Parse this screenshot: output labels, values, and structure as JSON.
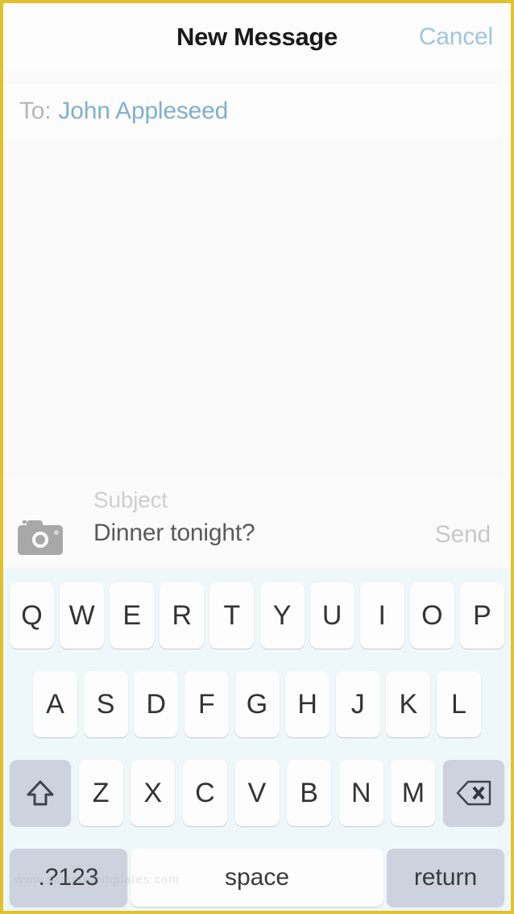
{
  "navbar": {
    "title": "New Message",
    "cancel_label": "Cancel"
  },
  "recipient": {
    "label": "To:",
    "value": "John Appleseed"
  },
  "compose": {
    "subject_placeholder": "Subject",
    "subject_value": "Dinner tonight?",
    "body_value": "",
    "send_label": "Send",
    "attach_icon": "camera-icon"
  },
  "keyboard": {
    "row1": [
      "Q",
      "W",
      "E",
      "R",
      "T",
      "Y",
      "U",
      "I",
      "O",
      "P"
    ],
    "row2": [
      "A",
      "S",
      "D",
      "F",
      "G",
      "H",
      "J",
      "K",
      "L"
    ],
    "row3_letters": [
      "Z",
      "X",
      "C",
      "V",
      "B",
      "N",
      "M"
    ],
    "shift_icon": "shift-arrow-icon",
    "backspace_icon": "backspace-delete-icon",
    "numbers_label": ".?123",
    "space_label": "space",
    "return_label": "return"
  },
  "watermark": {
    "text": "www.sampletemplates.com"
  },
  "colors": {
    "frame_border": "#e0c22e",
    "accent_blue": "#7eb1cd",
    "cancel_blue": "#9ec6dd",
    "keyboard_bg": "#eef8fb",
    "key_bg": "#fdfdfd",
    "special_key_bg": "#cdd3de",
    "disabled_gray": "#c9c9c9",
    "body_bg": "#fbfafa"
  }
}
